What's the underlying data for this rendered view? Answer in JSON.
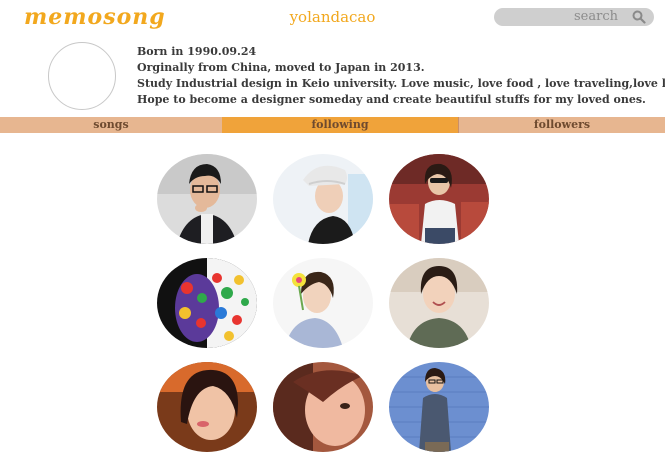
{
  "header": {
    "logo": "memosong",
    "username": "yolandacao",
    "search_placeholder": "search"
  },
  "profile": {
    "bio": [
      "Born in 1990.09.24",
      "Orginally from China, moved to Japan in 2013.",
      "Study Industrial design in Keio university. Love music, love food , love traveling,love life.",
      "Hope to become a designer someday and create beautiful stuffs for my loved ones."
    ]
  },
  "tabs": [
    {
      "label": "songs",
      "active": false
    },
    {
      "label": "following",
      "active": true
    },
    {
      "label": "followers",
      "active": false
    }
  ],
  "colors": {
    "brand": "#f2a81e",
    "tab_bar": "#e7b690",
    "tab_active": "#f0a33a"
  }
}
